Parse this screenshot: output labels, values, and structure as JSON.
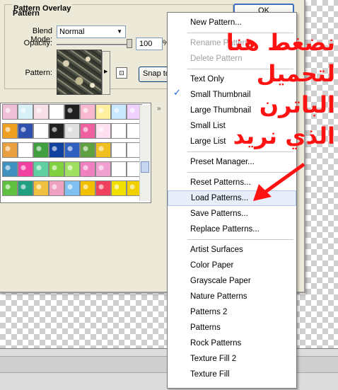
{
  "dialog": {
    "group_title": "Pattern Overlay",
    "subgroup_title": "Pattern",
    "blend_mode_label": "Blend Mode:",
    "blend_mode_value": "Normal",
    "opacity_label": "Opacity:",
    "opacity_value": "100",
    "opacity_unit": "%",
    "pattern_label": "Pattern:",
    "snap_button": "Snap to",
    "ok_button": "OK",
    "expand_glyph": "»"
  },
  "picker": {
    "patterns": [
      [
        "#f0c0d8",
        "#d8f0f8",
        "#f8e0e8",
        "#ffffff",
        "#202020",
        "#f8b8d0",
        "#fff0a0",
        "#c8e8ff",
        "#f0d0ff"
      ],
      [
        "#f0a020",
        "#3050b0",
        "#ffffff",
        "#202020",
        "#e0e0e0",
        "#f060a0",
        "#ffe0f0",
        "#ffffff",
        "#ffffff"
      ],
      [
        "#e8a040",
        "#ffffff",
        "#40a040",
        "#1040a0",
        "#3060c0",
        "#60a040",
        "#f0c020",
        "#ffffff",
        "#ffffff"
      ],
      [
        "#4090c0",
        "#f040a0",
        "#60d0a0",
        "#80d040",
        "#a0e060",
        "#f080c0",
        "#f0a0d0",
        "#ffffff",
        "#ffffff"
      ],
      [
        "#60c040",
        "#20a080",
        "#f0c040",
        "#f0a0c0",
        "#80c0f0",
        "#f0c000",
        "#f04060",
        "#f0e000",
        "#f0d000"
      ]
    ]
  },
  "menu": {
    "items": [
      {
        "label": "New Pattern...",
        "state": "normal"
      },
      {
        "sep": true
      },
      {
        "label": "Rename Pattern...",
        "state": "disabled"
      },
      {
        "label": "Delete Pattern",
        "state": "disabled"
      },
      {
        "sep": true
      },
      {
        "label": "Text Only",
        "state": "normal"
      },
      {
        "label": "Small Thumbnail",
        "state": "checked"
      },
      {
        "label": "Large Thumbnail",
        "state": "normal"
      },
      {
        "label": "Small List",
        "state": "normal"
      },
      {
        "label": "Large List",
        "state": "normal"
      },
      {
        "sep": true
      },
      {
        "label": "Preset Manager...",
        "state": "normal"
      },
      {
        "sep": true
      },
      {
        "label": "Reset Patterns...",
        "state": "normal"
      },
      {
        "label": "Load Patterns...",
        "state": "hover"
      },
      {
        "label": "Save Patterns...",
        "state": "normal"
      },
      {
        "label": "Replace Patterns...",
        "state": "normal"
      },
      {
        "sep": true
      },
      {
        "label": "Artist Surfaces",
        "state": "normal"
      },
      {
        "label": "Color Paper",
        "state": "normal"
      },
      {
        "label": "Grayscale Paper",
        "state": "normal"
      },
      {
        "label": "Nature Patterns",
        "state": "normal"
      },
      {
        "label": "Patterns 2",
        "state": "normal"
      },
      {
        "label": "Patterns",
        "state": "normal"
      },
      {
        "label": "Rock Patterns",
        "state": "normal"
      },
      {
        "label": "Texture Fill 2",
        "state": "normal"
      },
      {
        "label": "Texture Fill",
        "state": "normal"
      }
    ],
    "check_glyph": "✓"
  },
  "annotation": {
    "lines": [
      "نضغط هنا",
      "لتحميل",
      "الباترن",
      "الذي نريد"
    ],
    "color": "#ff1212"
  }
}
